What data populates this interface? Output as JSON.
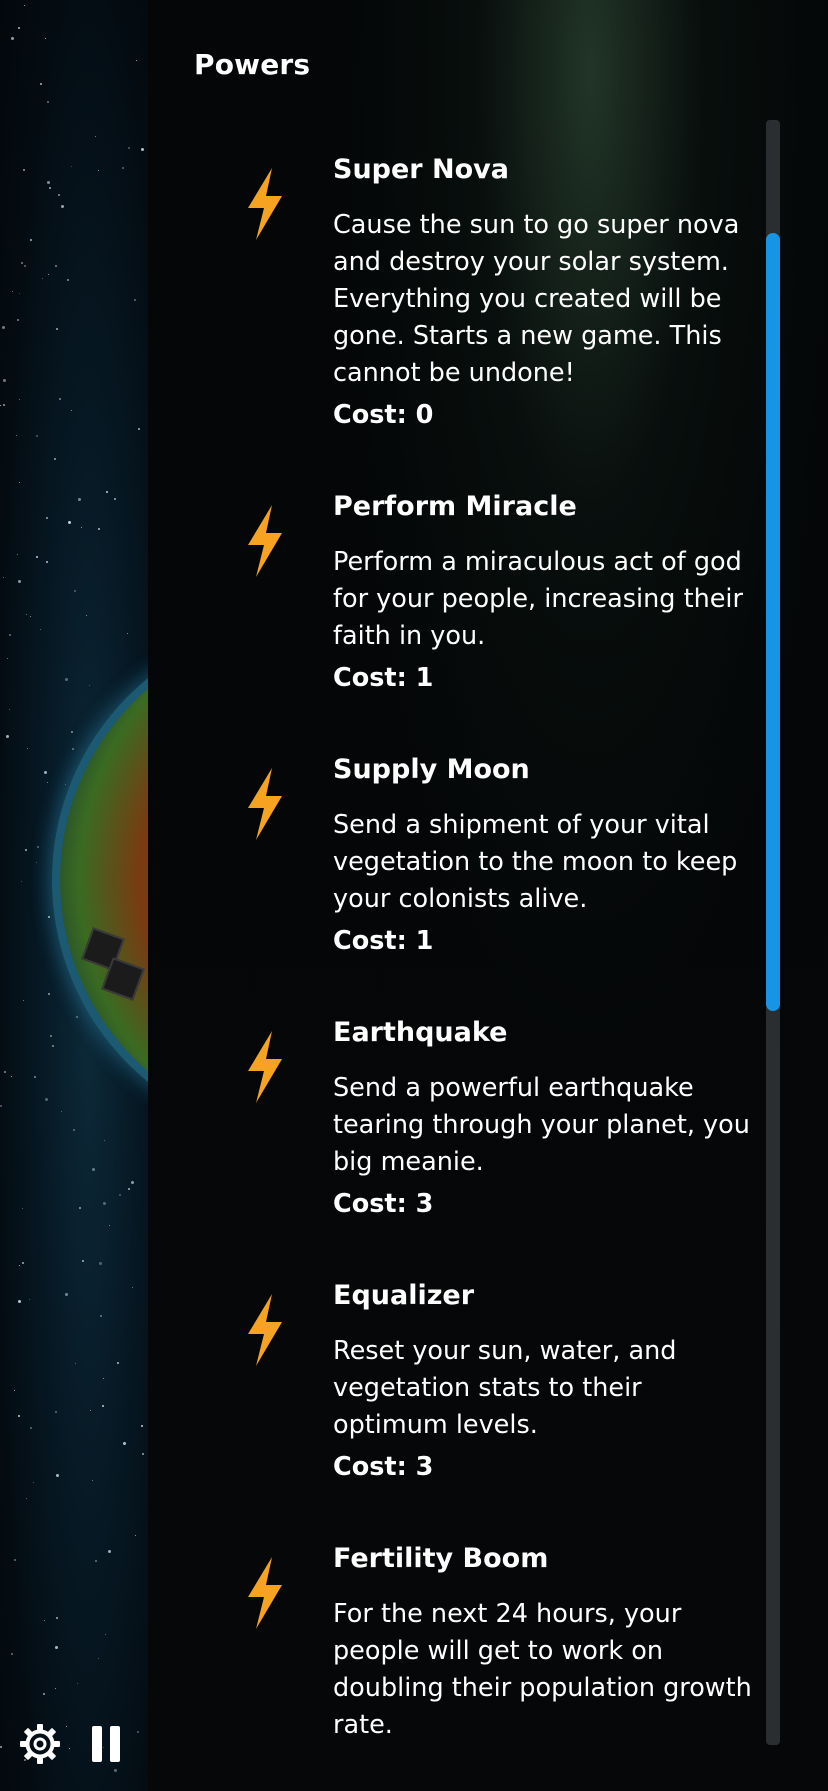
{
  "panel": {
    "title": "Powers"
  },
  "powers": [
    {
      "title": "Super Nova",
      "description": "Cause the sun to go super nova and destroy your solar system. Everything you created will be gone. Starts a new game. This cannot be undone!",
      "cost": "Cost: 0",
      "icon": "lightning-bolt-icon"
    },
    {
      "title": "Perform Miracle",
      "description": "Perform a miraculous act of god for your people, increasing their faith in you.",
      "cost": "Cost: 1",
      "icon": "lightning-bolt-icon"
    },
    {
      "title": "Supply Moon",
      "description": "Send a shipment of your vital vegetation to the moon to keep your colonists alive.",
      "cost": "Cost: 1",
      "icon": "lightning-bolt-icon"
    },
    {
      "title": "Earthquake",
      "description": "Send a powerful earthquake tearing through your planet, you big meanie.",
      "cost": "Cost: 3",
      "icon": "lightning-bolt-icon"
    },
    {
      "title": "Equalizer",
      "description": "Reset your sun, water, and vegetation stats to their optimum levels.",
      "cost": "Cost: 3",
      "icon": "lightning-bolt-icon"
    },
    {
      "title": "Fertility Boom",
      "description": "For the next 24 hours, your people will get to work on doubling their population growth rate.",
      "cost": "",
      "icon": "lightning-bolt-icon"
    }
  ],
  "controls": {
    "settings_icon": "gear-icon",
    "pause_icon": "pause-icon"
  },
  "colors": {
    "accent_bolt": "#f5a320",
    "scrollbar_thumb": "#1894e4",
    "scrollbar_track": "#2a2e31",
    "text": "#ffffff"
  },
  "scroll": {
    "position_fraction": 0.07,
    "visible_fraction": 0.48
  }
}
